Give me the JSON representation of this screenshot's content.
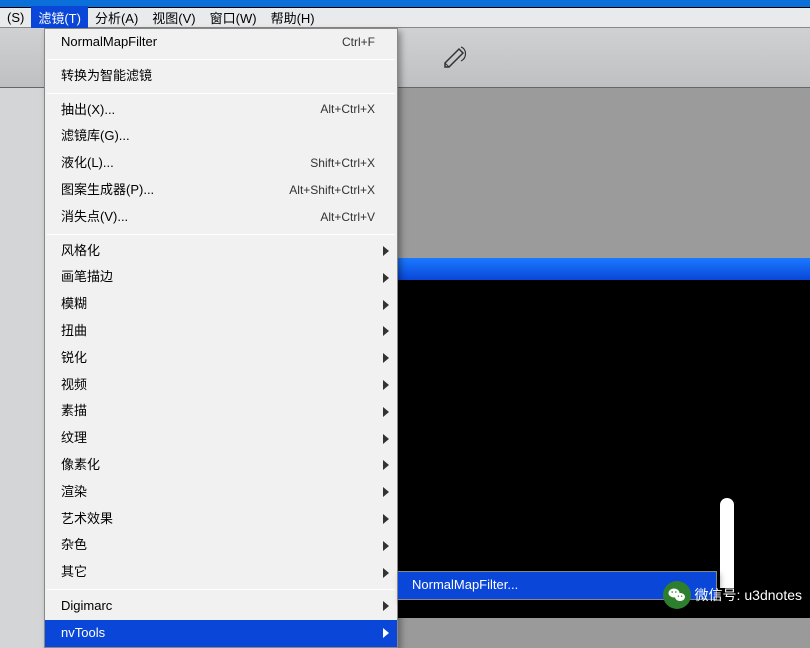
{
  "menubar": {
    "prefix": "(S)",
    "items": [
      "滤镜(T)",
      "分析(A)",
      "视图(V)",
      "窗口(W)",
      "帮助(H)"
    ],
    "active_index": 0
  },
  "dropdown": {
    "section1": [
      {
        "label": "NormalMapFilter",
        "shortcut": "Ctrl+F"
      }
    ],
    "section2": [
      {
        "label": "转换为智能滤镜"
      }
    ],
    "section3": [
      {
        "label": "抽出(X)...",
        "shortcut": "Alt+Ctrl+X"
      },
      {
        "label": "滤镜库(G)..."
      },
      {
        "label": "液化(L)...",
        "shortcut": "Shift+Ctrl+X"
      },
      {
        "label": "图案生成器(P)...",
        "shortcut": "Alt+Shift+Ctrl+X"
      },
      {
        "label": "消失点(V)...",
        "shortcut": "Alt+Ctrl+V"
      }
    ],
    "section4": [
      {
        "label": "风格化",
        "submenu": true
      },
      {
        "label": "画笔描边",
        "submenu": true
      },
      {
        "label": "模糊",
        "submenu": true
      },
      {
        "label": "扭曲",
        "submenu": true
      },
      {
        "label": "锐化",
        "submenu": true
      },
      {
        "label": "视频",
        "submenu": true
      },
      {
        "label": "素描",
        "submenu": true
      },
      {
        "label": "纹理",
        "submenu": true
      },
      {
        "label": "像素化",
        "submenu": true
      },
      {
        "label": "渲染",
        "submenu": true
      },
      {
        "label": "艺术效果",
        "submenu": true
      },
      {
        "label": "杂色",
        "submenu": true
      },
      {
        "label": "其它",
        "submenu": true
      }
    ],
    "section5": [
      {
        "label": "Digimarc",
        "submenu": true
      },
      {
        "label": "nvTools",
        "submenu": true,
        "highlighted": true
      }
    ]
  },
  "submenu": {
    "items": [
      {
        "label": "NormalMapFilter...",
        "highlighted": true
      }
    ]
  },
  "doc_title_suffix": "#)",
  "wechat": {
    "prefix": "微信号:",
    "id": "u3dnotes"
  }
}
